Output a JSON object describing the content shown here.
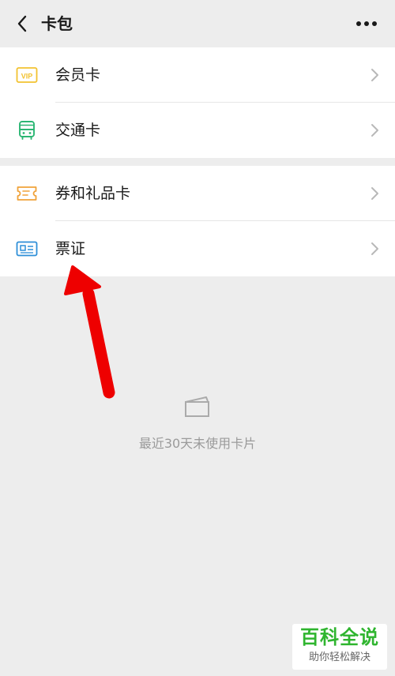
{
  "header": {
    "title": "卡包",
    "back_icon": "chevron-left-icon",
    "more_icon": "more-dots-icon"
  },
  "groups": [
    {
      "items": [
        {
          "label": "会员卡",
          "icon": "vip-card-icon",
          "icon_color": "#f2c230"
        },
        {
          "label": "交通卡",
          "icon": "bus-icon",
          "icon_color": "#2bb673"
        }
      ]
    },
    {
      "items": [
        {
          "label": "券和礼品卡",
          "icon": "ticket-icon",
          "icon_color": "#f0a23a"
        },
        {
          "label": "票证",
          "icon": "id-card-icon",
          "icon_color": "#2e8fd8"
        }
      ]
    }
  ],
  "empty_state": {
    "icon": "card-outline-icon",
    "text": "最近30天未使用卡片"
  },
  "annotation": {
    "arrow_color": "#ee0000"
  },
  "watermark": {
    "title": "百科全说",
    "subtitle": "助你轻松解决"
  }
}
